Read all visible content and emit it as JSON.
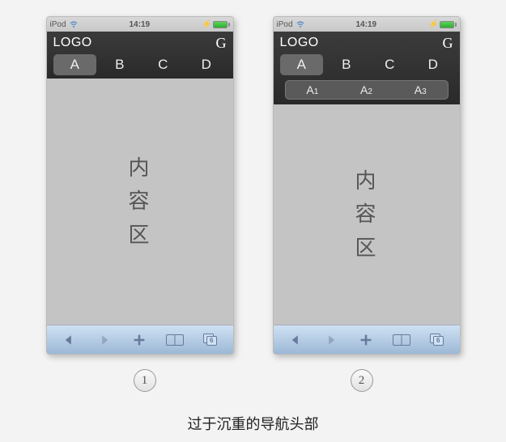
{
  "status": {
    "device": "iPod",
    "time": "14:19"
  },
  "header": {
    "logo": "LOGO",
    "right": "G"
  },
  "tabs": [
    "A",
    "B",
    "C",
    "D"
  ],
  "subtabs": [
    {
      "main": "A",
      "sub": "1"
    },
    {
      "main": "A",
      "sub": "2"
    },
    {
      "main": "A",
      "sub": "3"
    }
  ],
  "content": {
    "l1": "内",
    "l2": "容",
    "l3": "区"
  },
  "bottombar": {
    "tabcount": "6"
  },
  "figures": {
    "one": "1",
    "two": "2"
  },
  "caption": "过于沉重的导航头部"
}
